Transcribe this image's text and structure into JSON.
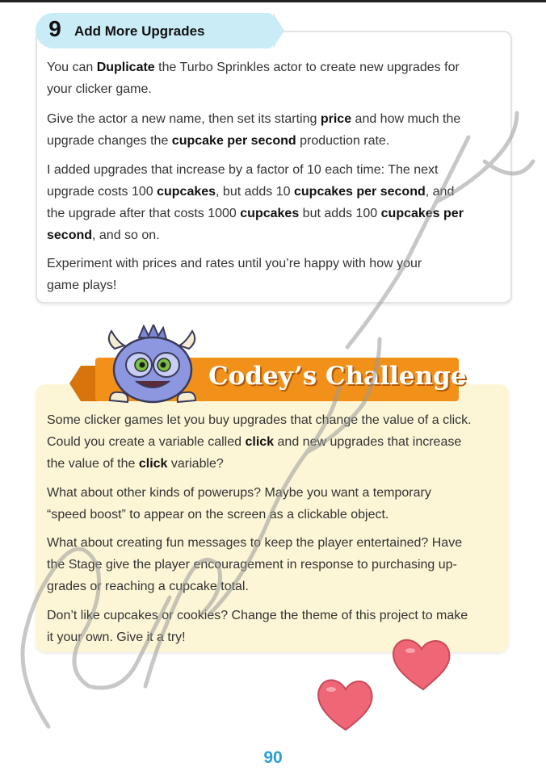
{
  "step": {
    "number": "9",
    "title": "Add More Upgrades",
    "paragraphs": [
      {
        "lines": [
          [
            {
              "t": "You can "
            },
            {
              "t": "Duplicate",
              "b": true
            },
            {
              "t": " the Turbo Sprinkles actor to create new upgrades for"
            }
          ],
          [
            {
              "t": "your clicker game."
            }
          ]
        ]
      },
      {
        "lines": [
          [
            {
              "t": "Give the actor a new name, then set its starting "
            },
            {
              "t": "price",
              "b": true
            },
            {
              "t": " and how much the"
            }
          ],
          [
            {
              "t": "upgrade changes the "
            },
            {
              "t": "cupcake per second",
              "b": true
            },
            {
              "t": " production rate."
            }
          ]
        ]
      },
      {
        "lines": [
          [
            {
              "t": "I added upgrades that increase by a factor of 10 each time: The next"
            }
          ],
          [
            {
              "t": "upgrade costs 100 "
            },
            {
              "t": "cupcakes",
              "b": true
            },
            {
              "t": ", but adds 10 "
            },
            {
              "t": "cupcakes per second",
              "b": true
            },
            {
              "t": ", and"
            }
          ],
          [
            {
              "t": "the upgrade after that costs 1000 "
            },
            {
              "t": "cupcakes",
              "b": true
            },
            {
              "t": " but adds 100 "
            },
            {
              "t": "cupcakes per",
              "b": true
            }
          ],
          [
            {
              "t": "second",
              "b": true
            },
            {
              "t": ", and so on."
            }
          ]
        ]
      },
      {
        "lines": [
          [
            {
              "t": "Experiment with prices and rates until you’re happy with how your"
            }
          ],
          [
            {
              "t": "game plays!"
            }
          ]
        ]
      }
    ]
  },
  "challenge": {
    "title": "Codey’s Challenge",
    "paragraphs": [
      {
        "lines": [
          [
            {
              "t": "Some clicker games let you buy upgrades that change the value of a click."
            }
          ],
          [
            {
              "t": "Could you create a variable called "
            },
            {
              "t": "click",
              "b": true
            },
            {
              "t": " and new upgrades that increase"
            }
          ],
          [
            {
              "t": "the value of the "
            },
            {
              "t": "click",
              "b": true
            },
            {
              "t": " variable?"
            }
          ]
        ]
      },
      {
        "lines": [
          [
            {
              "t": "What about other kinds of powerups? Maybe you want a temporary"
            }
          ],
          [
            {
              "t": "“speed boost” to appear on the screen as a clickable object."
            }
          ]
        ]
      },
      {
        "lines": [
          [
            {
              "t": "What about creating fun messages to keep the player entertained? Have"
            }
          ],
          [
            {
              "t": "the Stage give the player encouragement in response to purchasing up-"
            }
          ],
          [
            {
              "t": "grades or reaching a cupcake total."
            }
          ]
        ]
      },
      {
        "lines": [
          [
            {
              "t": "Don’t like cupcakes or cookies? Change the theme of this project to make"
            }
          ],
          [
            {
              "t": "it your own. Give it a try!"
            }
          ]
        ]
      }
    ]
  },
  "page_number": "90",
  "icons": {
    "mascot": "codey-monster-icon",
    "decoration": "hearts-icon"
  },
  "colors": {
    "tab": "#c9ecf7",
    "ribbon": "#f19119",
    "challenge_bg": "#fdf6d6",
    "page_number": "#2a9fd6",
    "heart": "#ef6677"
  }
}
